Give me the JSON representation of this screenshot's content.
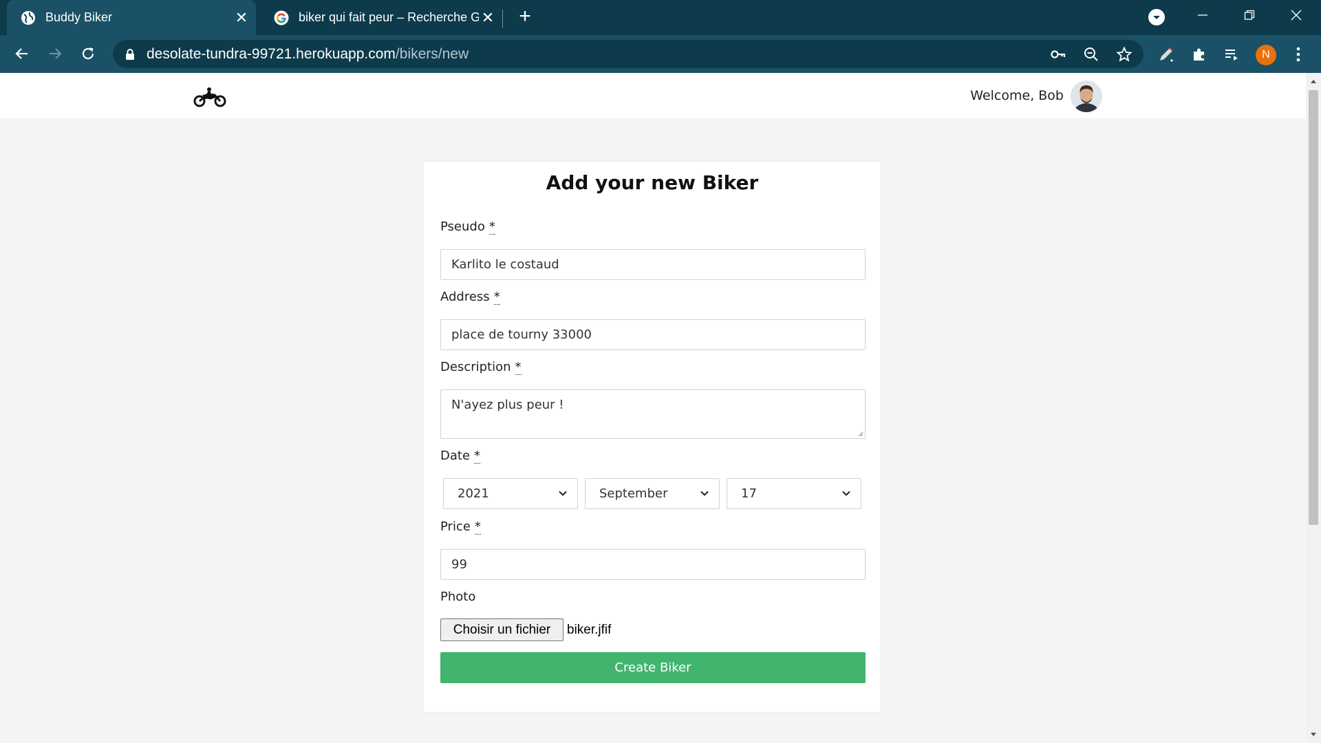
{
  "browser": {
    "tabs": [
      {
        "title": "Buddy Biker",
        "favicon": "globe-icon",
        "active": true
      },
      {
        "title": "biker qui fait peur – Recherche G",
        "favicon": "google-icon",
        "active": false
      }
    ],
    "url": {
      "host": "desolate-tundra-99721.herokuapp.com",
      "path": "/bikers/new"
    },
    "profile_initial": "N",
    "colors": {
      "tabstrip": "#0d3b4c",
      "toolbar": "#1a5166",
      "profile": "#e8710a"
    }
  },
  "navbar": {
    "logo": "motorcycle-icon",
    "welcome": "Welcome, Bob"
  },
  "form": {
    "title": "Add your new Biker",
    "required_marker": "*",
    "pseudo": {
      "label": "Pseudo",
      "value": "Karlito le costaud"
    },
    "address": {
      "label": "Address",
      "value": "place de tourny 33000"
    },
    "description": {
      "label": "Description",
      "value": "N'ayez plus peur !"
    },
    "date": {
      "label": "Date",
      "year": "2021",
      "month": "September",
      "day": "17"
    },
    "price": {
      "label": "Price",
      "value": "99"
    },
    "photo": {
      "label": "Photo",
      "button": "Choisir un fichier",
      "file": "biker.jfif"
    },
    "submit": "Create Biker",
    "submit_color": "#41b56e"
  }
}
